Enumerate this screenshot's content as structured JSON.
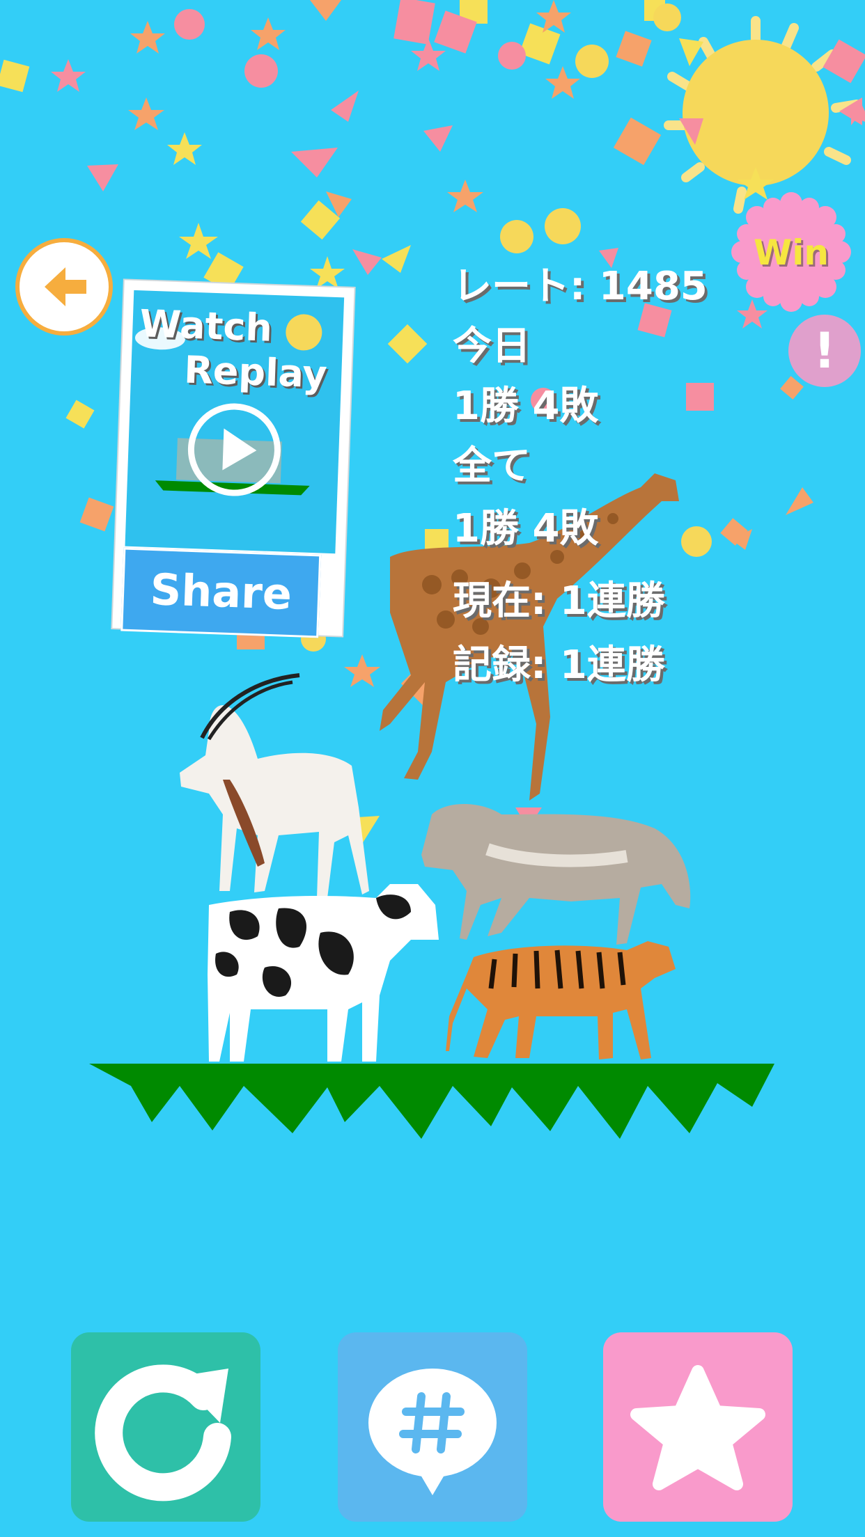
{
  "result": {
    "badge": "Win"
  },
  "replay_card": {
    "title_line1": "Watch",
    "title_line2": "Replay",
    "share_label": "Share"
  },
  "stats": {
    "rate": "レート: 1485",
    "today_label": "今日",
    "today_record": "1勝 4敗",
    "all_label": "全て",
    "all_record": "1勝 4敗",
    "current_streak": "現在: 1連勝",
    "best_streak": "記録: 1連勝"
  },
  "icons": {
    "back": "arrow-left-icon",
    "play": "play-icon",
    "alert": "exclamation-icon",
    "retry": "refresh-icon",
    "hashtag": "hashtag-speech-icon",
    "star": "star-icon"
  },
  "colors": {
    "background": "#33cef7",
    "ground": "#008a00",
    "back_border": "#f6ad3e",
    "share": "#3ea8ef",
    "retry": "#2ec0a8",
    "hashtag": "#5bb7ef",
    "star": "#f99acb",
    "win_badge": "#f99acb",
    "win_text": "#f6e640"
  }
}
